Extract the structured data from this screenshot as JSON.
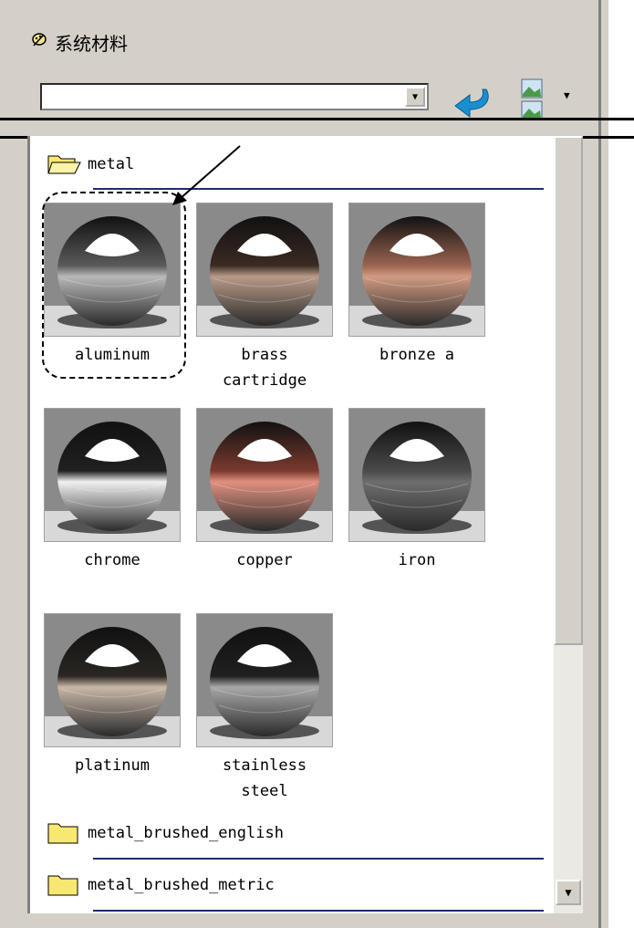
{
  "header": {
    "title": "系统材料",
    "combo_value": ""
  },
  "folders": [
    {
      "label": "metal",
      "state": "open"
    },
    {
      "label": "metal_brushed_english",
      "state": "closed"
    },
    {
      "label": "metal_brushed_metric",
      "state": "closed"
    }
  ],
  "materials": [
    {
      "label": "aluminum",
      "base": "#5a5a5a",
      "bottom": "#b8b8b8"
    },
    {
      "label": "brass\ncartridge",
      "base": "#3a2a22",
      "bottom": "#b89a88"
    },
    {
      "label": "bronze a",
      "base": "#9a6450",
      "bottom": "#d09a82"
    },
    {
      "label": "chrome",
      "base": "#202020",
      "bottom": "#f0f0f0"
    },
    {
      "label": "copper",
      "base": "#7a3a2e",
      "bottom": "#e09080"
    },
    {
      "label": "iron",
      "base": "#4a4a4a",
      "bottom": "#6e6e6e"
    },
    {
      "label": "platinum",
      "base": "#2a2622",
      "bottom": "#c8b8a8"
    },
    {
      "label": "stainless\nsteel",
      "base": "#202020",
      "bottom": "#a8a8a8"
    }
  ],
  "selected": "aluminum"
}
